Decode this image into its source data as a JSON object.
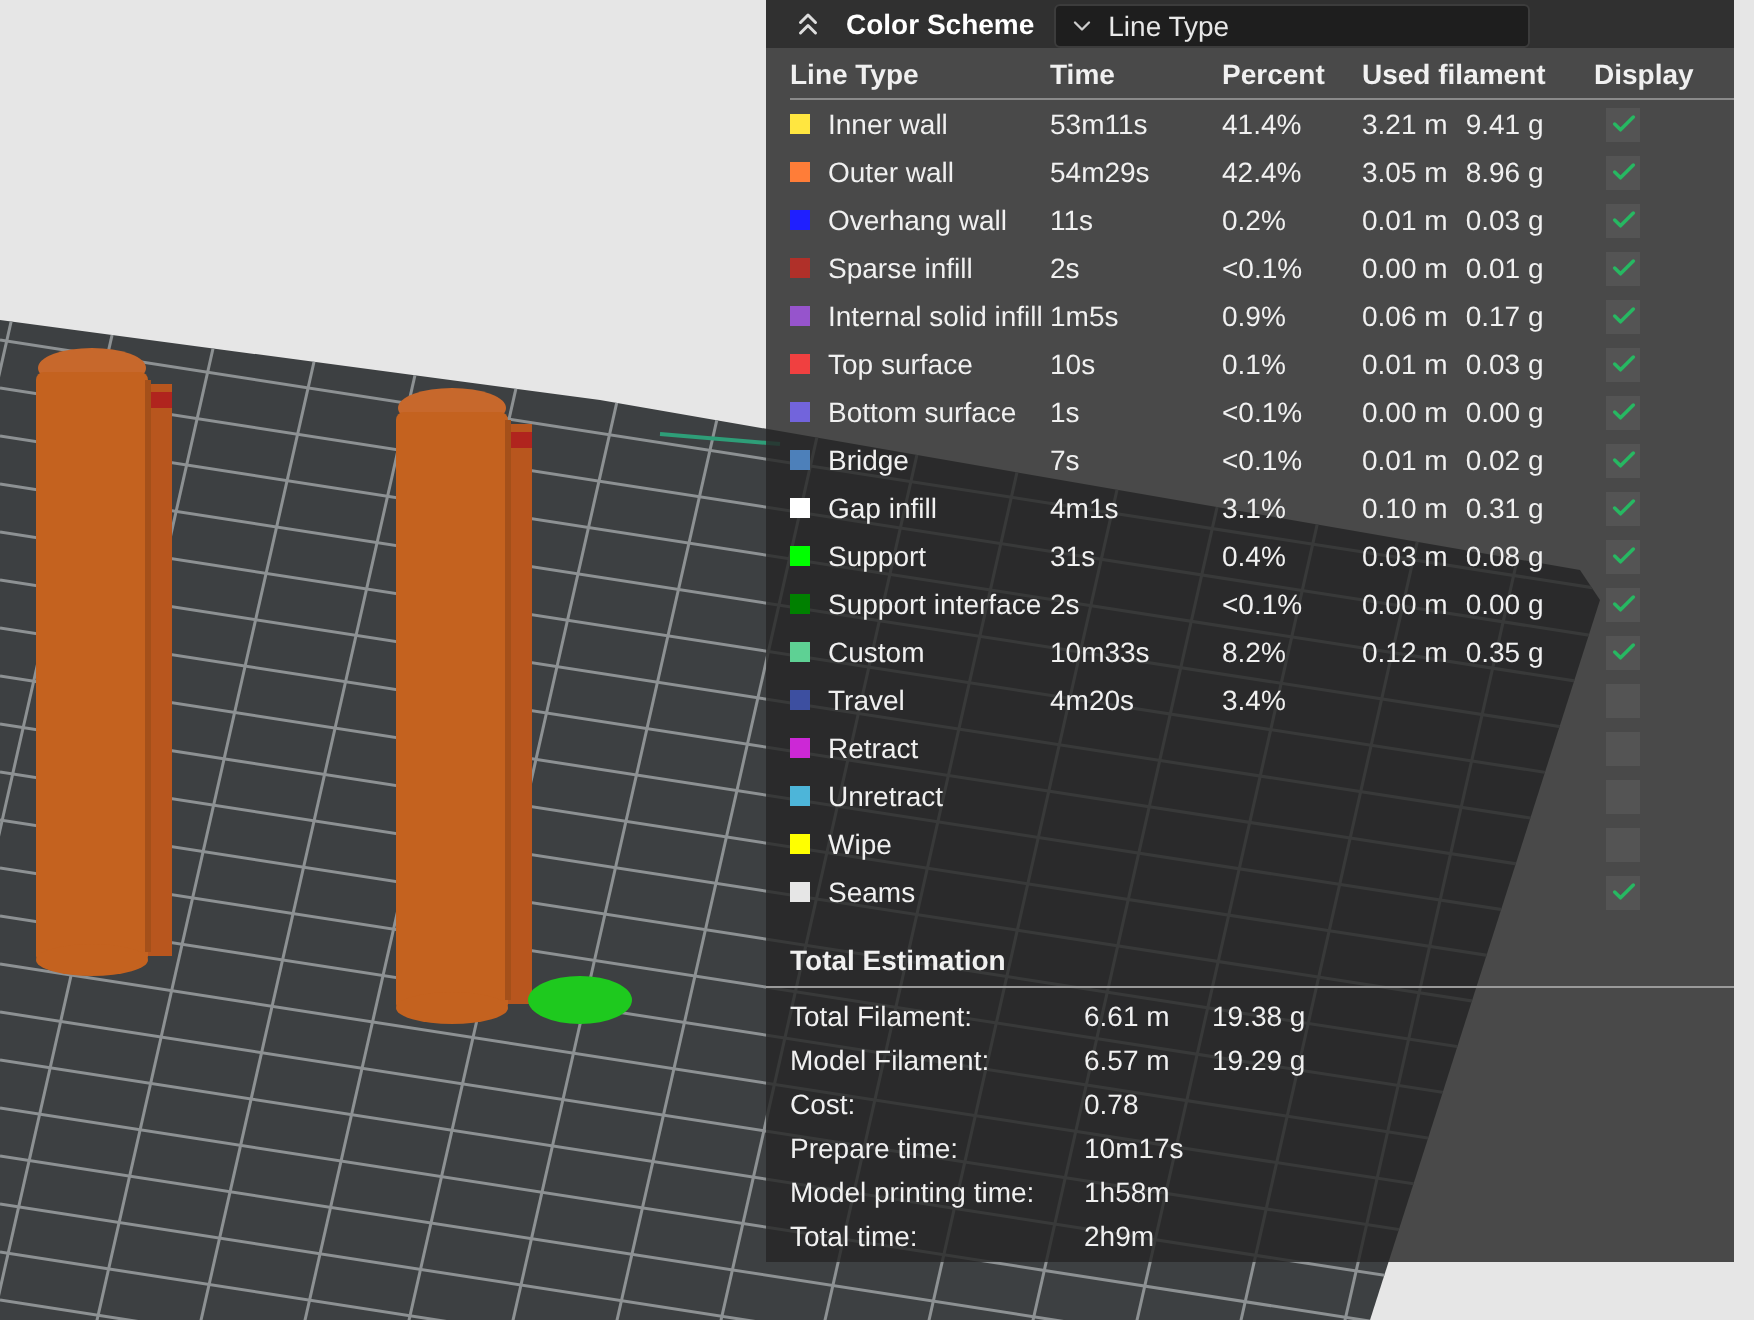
{
  "panel": {
    "title": "Color Scheme",
    "scheme_select": {
      "value": "Line Type"
    },
    "columns": [
      "Line Type",
      "Time",
      "Percent",
      "Used filament",
      "Display"
    ],
    "rows": [
      {
        "name": "Inner wall",
        "color": "#ffe640",
        "time": "53m11s",
        "percent": "41.4%",
        "length": "3.21 m",
        "weight": "9.41 g",
        "checked": true
      },
      {
        "name": "Outer wall",
        "color": "#ff7d38",
        "time": "54m29s",
        "percent": "42.4%",
        "length": "3.05 m",
        "weight": "8.96 g",
        "checked": true
      },
      {
        "name": "Overhang wall",
        "color": "#1f1fff",
        "time": "11s",
        "percent": "0.2%",
        "length": "0.01 m",
        "weight": "0.03 g",
        "checked": true
      },
      {
        "name": "Sparse infill",
        "color": "#b03029",
        "time": "2s",
        "percent": "<0.1%",
        "length": "0.00 m",
        "weight": "0.01 g",
        "checked": true
      },
      {
        "name": "Internal solid infill",
        "color": "#9654cc",
        "time": "1m5s",
        "percent": "0.9%",
        "length": "0.06 m",
        "weight": "0.17 g",
        "checked": true
      },
      {
        "name": "Top surface",
        "color": "#f04040",
        "time": "10s",
        "percent": "0.1%",
        "length": "0.01 m",
        "weight": "0.03 g",
        "checked": true
      },
      {
        "name": "Bottom surface",
        "color": "#7264dc",
        "time": "1s",
        "percent": "<0.1%",
        "length": "0.00 m",
        "weight": "0.00 g",
        "checked": true
      },
      {
        "name": "Bridge",
        "color": "#4d80ba",
        "time": "7s",
        "percent": "<0.1%",
        "length": "0.01 m",
        "weight": "0.02 g",
        "checked": true
      },
      {
        "name": "Gap infill",
        "color": "#ffffff",
        "time": "4m1s",
        "percent": "3.1%",
        "length": "0.10 m",
        "weight": "0.31 g",
        "checked": true
      },
      {
        "name": "Support",
        "color": "#00ff00",
        "time": "31s",
        "percent": "0.4%",
        "length": "0.03 m",
        "weight": "0.08 g",
        "checked": true
      },
      {
        "name": "Support interface",
        "color": "#008000",
        "time": "2s",
        "percent": "<0.1%",
        "length": "0.00 m",
        "weight": "0.00 g",
        "checked": true
      },
      {
        "name": "Custom",
        "color": "#5ed194",
        "time": "10m33s",
        "percent": "8.2%",
        "length": "0.12 m",
        "weight": "0.35 g",
        "checked": true
      },
      {
        "name": "Travel",
        "color": "#3d4fa0",
        "time": "4m20s",
        "percent": "3.4%",
        "checked": false
      },
      {
        "name": "Retract",
        "color": "#cc28d6",
        "checked": false
      },
      {
        "name": "Unretract",
        "color": "#4db5d9",
        "checked": false
      },
      {
        "name": "Wipe",
        "color": "#ffff00",
        "checked": false
      },
      {
        "name": "Seams",
        "color": "#e6e6e6",
        "checked": true
      }
    ],
    "total_estimation": {
      "title": "Total Estimation",
      "rows": [
        {
          "label": "Total Filament:",
          "value": "6.61 m",
          "value_2": "19.38 g"
        },
        {
          "label": "Model Filament:",
          "value": "6.57 m",
          "value_2": "19.29 g"
        },
        {
          "label": "Cost:",
          "value": "0.78"
        },
        {
          "label": "Prepare time:",
          "value": "10m17s"
        },
        {
          "label": "Model printing time:",
          "value": "1h58m"
        },
        {
          "label": "Total time:",
          "value": "2h9m"
        }
      ]
    }
  }
}
